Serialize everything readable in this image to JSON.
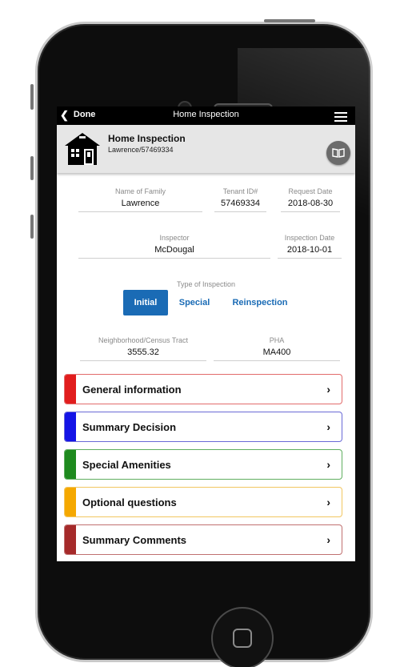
{
  "topbar": {
    "done_label": "Done",
    "title": "Home Inspection"
  },
  "header": {
    "title": "Home Inspection",
    "subtitle": "Lawrence/57469334"
  },
  "form": {
    "name_of_family": {
      "label": "Name of Family",
      "value": "Lawrence"
    },
    "tenant_id": {
      "label": "Tenant ID#",
      "value": "57469334"
    },
    "request_date": {
      "label": "Request Date",
      "value": "2018-08-30"
    },
    "inspector": {
      "label": "Inspector",
      "value": "McDougal"
    },
    "inspection_date": {
      "label": "Inspection Date",
      "value": "2018-10-01"
    },
    "type_of_inspection": {
      "label": "Type of Inspection",
      "options": [
        "Initial",
        "Special",
        "Reinspection"
      ],
      "selected": "Initial"
    },
    "census_tract": {
      "label": "Neighborhood/Census Tract",
      "value": "3555.32"
    },
    "pha": {
      "label": "PHA",
      "value": "MA400"
    }
  },
  "sections": [
    {
      "title": "General information",
      "color": "#e11d1d",
      "border": "#e26b6b"
    },
    {
      "title": "Summary Decision",
      "color": "#1414e6",
      "border": "#6a6ad6"
    },
    {
      "title": "Special Amenities",
      "color": "#1e8a1e",
      "border": "#5fae5f"
    },
    {
      "title": "Optional questions",
      "color": "#f5a800",
      "border": "#f2c660"
    },
    {
      "title": "Summary Comments",
      "color": "#a52a2a",
      "border": "#c07070"
    }
  ],
  "arrow_glyph": "›",
  "colors": {
    "accent": "#1a6bb5",
    "topbar": "#000000",
    "header_bg": "#e6e6e6"
  }
}
